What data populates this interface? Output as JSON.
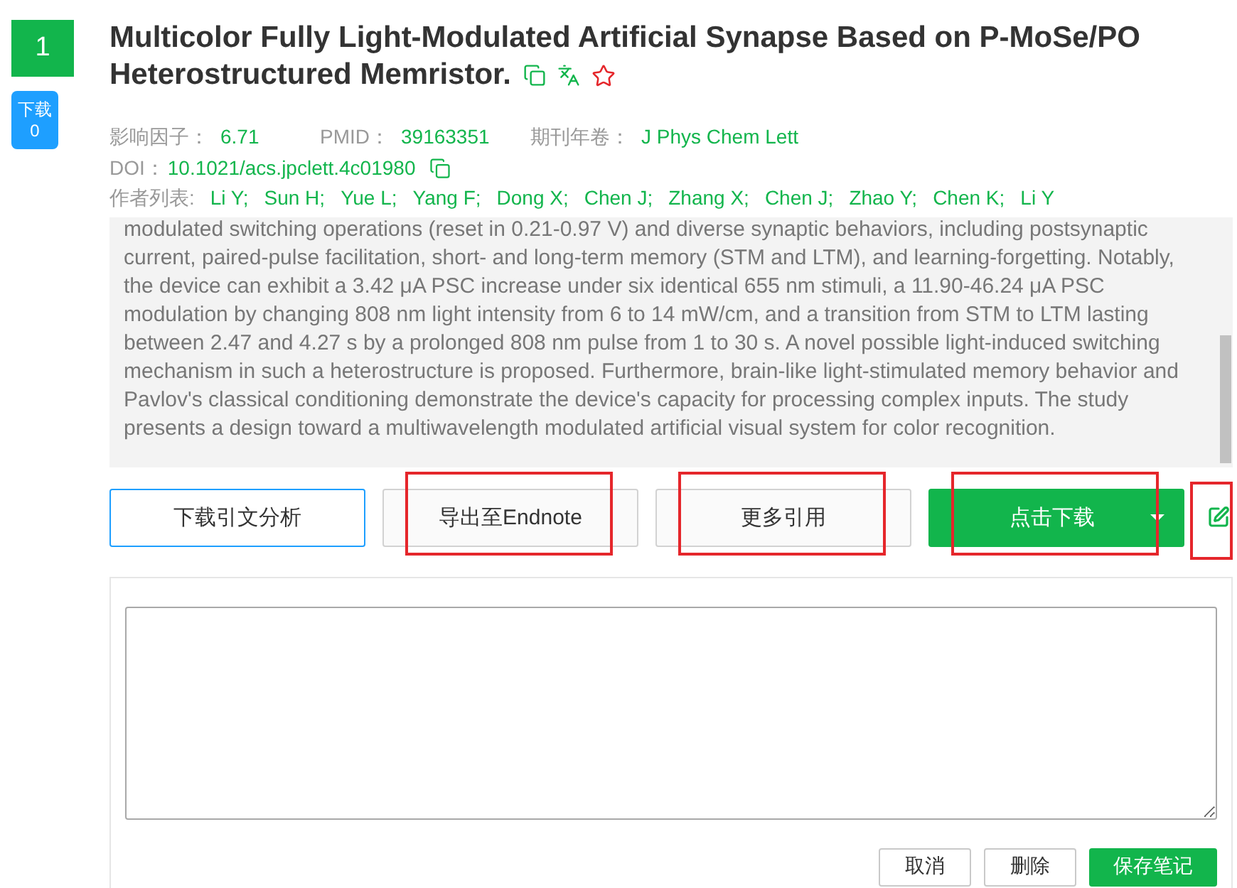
{
  "rank": "1",
  "download_badge": {
    "label": "下载",
    "count": "0"
  },
  "title_lines": [
    "Multicolor Fully Light-Modulated Artificial Synapse Based on P-MoSe/PO",
    "Heterostructured Memristor."
  ],
  "favorited": false,
  "meta": [
    {
      "label": "影响因子：",
      "value": "6.71"
    },
    {
      "label": "PMID：",
      "value": "39163351"
    },
    {
      "label": "期刊年卷：",
      "value": "J Phys Chem Lett"
    }
  ],
  "doi": {
    "label": "DOI：",
    "value": "10.1021/acs.jpclett.4c01980"
  },
  "authors": {
    "label": "作者列表:",
    "names": [
      "Li Y;",
      "Sun H;",
      "Yue L;",
      "Yang F;",
      "Dong X;",
      "Chen J;",
      "Zhang X;",
      "Chen J;",
      "Zhao Y;",
      "Chen K;",
      "Li Y"
    ]
  },
  "abstract": "modulated switching operations (reset in 0.21-0.97 V) and diverse synaptic behaviors, including postsynaptic current, paired-pulse facilitation, short- and long-term memory (STM and LTM), and learning-forgetting. Notably, the device can exhibit a 3.42 μA PSC increase under six identical 655 nm stimuli, a 11.90-46.24 μA PSC modulation by changing 808 nm light intensity from 6 to 14 mW/cm, and a transition from STM to LTM lasting between 2.47 and 4.27 s by a prolonged 808 nm pulse from 1 to 30 s. A novel possible light-induced switching mechanism in such a heterostructure is proposed. Furthermore, brain-like light-stimulated memory behavior and Pavlov's classical conditioning demonstrate the device's capacity for processing complex inputs. The study presents a design toward a multiwavelength modulated artificial visual system for color recognition.",
  "actions": [
    {
      "label": "下载引文分析",
      "kind": "outline",
      "highlighted": false
    },
    {
      "label": "导出至Endnote",
      "kind": "plain",
      "highlighted": true
    },
    {
      "label": "更多引用",
      "kind": "plain",
      "highlighted": true
    },
    {
      "label": "点击下载",
      "kind": "split",
      "highlighted": true
    }
  ],
  "note_toggle": {
    "highlighted": true
  },
  "notes": {
    "buttons": [
      {
        "label": "取消",
        "kind": "plain"
      },
      {
        "label": "删除",
        "kind": "plain"
      },
      {
        "label": "保存笔记",
        "kind": "primary"
      }
    ]
  }
}
